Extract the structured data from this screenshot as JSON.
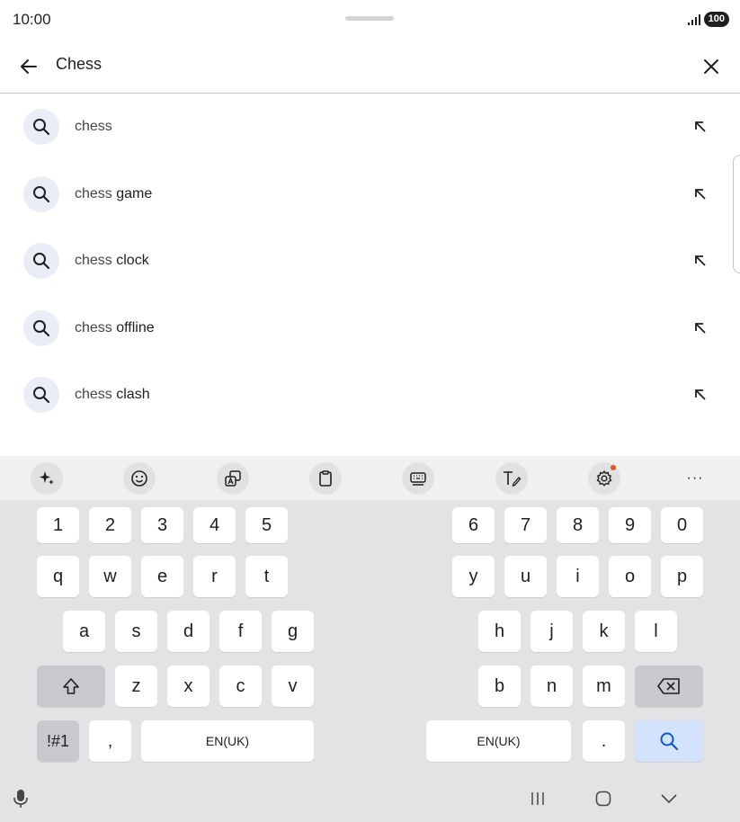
{
  "status": {
    "time": "10:00",
    "battery": "100"
  },
  "search": {
    "query": "Chess"
  },
  "suggestions": [
    {
      "prefix": "chess",
      "suffix": ""
    },
    {
      "prefix": "chess",
      "suffix": " game"
    },
    {
      "prefix": "chess",
      "suffix": " clock"
    },
    {
      "prefix": "chess",
      "suffix": " offline"
    },
    {
      "prefix": "chess",
      "suffix": " clash"
    }
  ],
  "toolbar": {
    "icons": [
      "ai-sparkle-icon",
      "emoji-icon",
      "translate-icon",
      "clipboard-icon",
      "keyboard-mode-icon",
      "text-edit-icon",
      "settings-icon",
      "more-icon"
    ],
    "more_label": "···"
  },
  "keyboard": {
    "numbers_left": [
      "1",
      "2",
      "3",
      "4",
      "5"
    ],
    "numbers_right": [
      "6",
      "7",
      "8",
      "9",
      "0"
    ],
    "row1_left": [
      "q",
      "w",
      "e",
      "r",
      "t"
    ],
    "row1_right": [
      "y",
      "u",
      "i",
      "o",
      "p"
    ],
    "row2_left": [
      "a",
      "s",
      "d",
      "f",
      "g"
    ],
    "row2_right": [
      "h",
      "j",
      "k",
      "l"
    ],
    "row3_left": [
      "z",
      "x",
      "c",
      "v"
    ],
    "row3_right": [
      "b",
      "n",
      "m"
    ],
    "symbols_label": "!#1",
    "comma_label": ",",
    "period_label": ".",
    "space_left_label": "EN(UK)",
    "space_right_label": "EN(UK)"
  },
  "colors": {
    "accent": "#0b57d0",
    "search_key": "#d3e3fd",
    "keyboard_bg": "#e3e3e5",
    "notification_dot": "#e8541c"
  }
}
